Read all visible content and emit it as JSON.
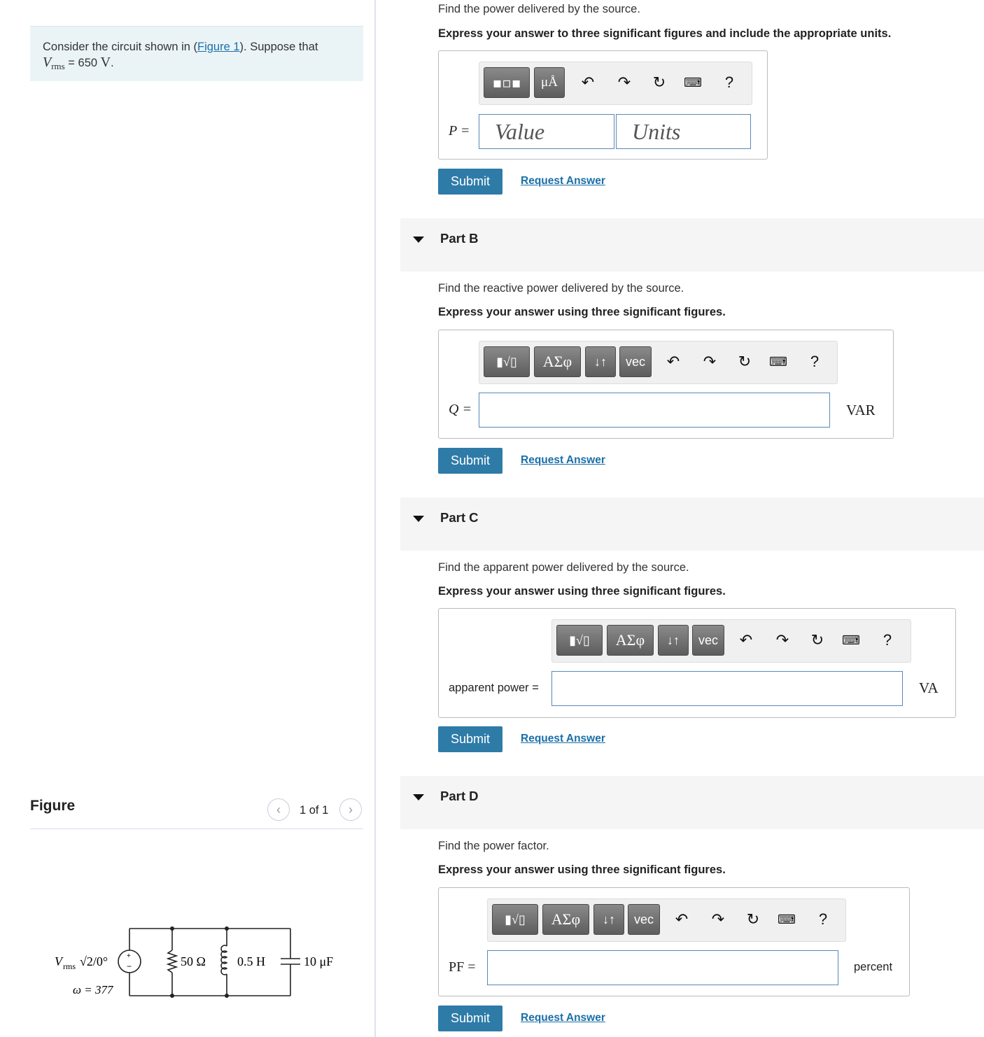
{
  "problem": {
    "text_before": "Consider the circuit shown in (",
    "figure_link": "Figure 1",
    "text_after": "). Suppose that",
    "var_main": "V",
    "var_sub": "rms",
    "equals": " = 650 ",
    "unit": "V",
    "period": "."
  },
  "figure": {
    "title": "Figure",
    "pager": "1 of 1",
    "source_label_v": "V",
    "source_label_sub": "rms",
    "source_label_rest": "√2/0°",
    "omega": "ω = 377",
    "resistor": "50 Ω",
    "inductor": "0.5 H",
    "capacitor": "10 μF"
  },
  "partA": {
    "question": "Find the power delivered by the source.",
    "instruction": "Express your answer to three significant figures and include the appropriate units.",
    "label": "P =",
    "value_placeholder": "Value",
    "units_placeholder": "Units",
    "tool_units": "μÅ",
    "submit": "Submit",
    "request": "Request Answer"
  },
  "partB": {
    "title": "Part B",
    "question": "Find the reactive power delivered by the source.",
    "instruction": "Express your answer using three significant figures.",
    "label": "Q =",
    "unit": "VAR",
    "submit": "Submit",
    "request": "Request Answer"
  },
  "partC": {
    "title": "Part C",
    "question": "Find the apparent power delivered by the source.",
    "instruction": "Express your answer using three significant figures.",
    "label": "apparent power =",
    "unit": "VA",
    "submit": "Submit",
    "request": "Request Answer"
  },
  "partD": {
    "title": "Part D",
    "question": "Find the power factor.",
    "instruction": "Express your answer using three significant figures.",
    "label": "PF =",
    "unit": "percent",
    "submit": "Submit",
    "request": "Request Answer"
  },
  "toolbar": {
    "greek": "ΑΣφ",
    "vec": "vec",
    "sort": "↓↑",
    "help": "?"
  }
}
